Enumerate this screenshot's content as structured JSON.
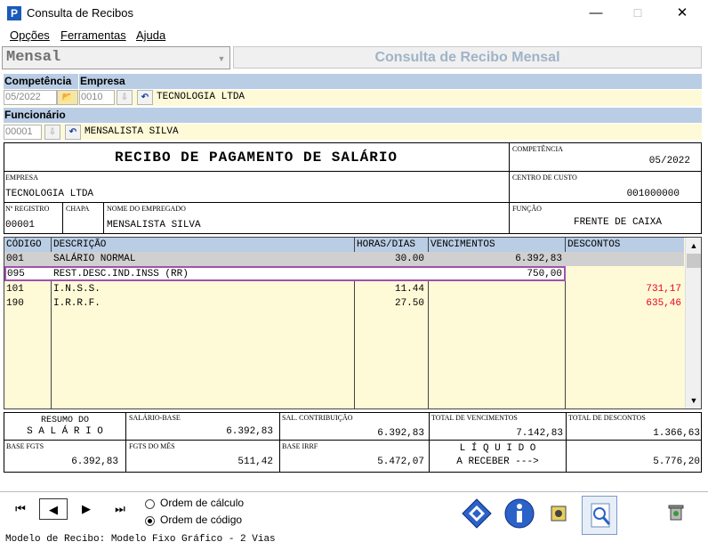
{
  "window": {
    "title": "Consulta de Recibos",
    "icon_letter": "P",
    "minimize": "—",
    "maximize": "☐",
    "close": "✕"
  },
  "menu": [
    "Opções",
    "Ferramentas",
    "Ajuda"
  ],
  "type_combo": {
    "value": "Mensal"
  },
  "header_title": "Consulta de Recibo Mensal",
  "filters": {
    "competencia_label": "Competência",
    "empresa_label": "Empresa",
    "competencia_value": "05/2022",
    "empresa_code": "0010",
    "empresa_name": "TECNOLOGIA LTDA",
    "funcionario_label": "Funcionário",
    "funcionario_code": "00001",
    "funcionario_name": "MENSALISTA SILVA"
  },
  "receipt": {
    "title": "RECIBO DE PAGAMENTO DE SALÁRIO",
    "competencia_label": "COMPETÊNCIA",
    "competencia": "05/2022",
    "empresa_label": "EMPRESA",
    "empresa": "TECNOLOGIA LTDA",
    "centro_label": "CENTRO DE CUSTO",
    "centro": "001000000",
    "registro_label": "Nº REGISTRO",
    "registro": "00001",
    "chapa_label": "CHAPA",
    "nome_label": "NOME DO EMPREGADO",
    "nome": "MENSALISTA SILVA",
    "funcao_label": "FUNÇÃO",
    "funcao": "FRENTE DE CAIXA"
  },
  "grid": {
    "columns": [
      "CÓDIGO",
      "DESCRIÇÃO",
      "HORAS/DIAS",
      "VENCIMENTOS",
      "DESCONTOS"
    ],
    "rows": [
      {
        "codigo": "001",
        "descricao": "SALÁRIO NORMAL",
        "horas": "30.00",
        "vencimentos": "6.392,83",
        "descontos": ""
      },
      {
        "codigo": "095",
        "descricao": "REST.DESC.IND.INSS (RR)",
        "horas": "",
        "vencimentos": "750,00",
        "descontos": ""
      },
      {
        "codigo": "101",
        "descricao": "I.N.S.S.",
        "horas": "11.44",
        "vencimentos": "",
        "descontos": "731,17"
      },
      {
        "codigo": "190",
        "descricao": "I.R.R.F.",
        "horas": "27.50",
        "vencimentos": "",
        "descontos": "635,46"
      }
    ],
    "scroll_up": "▲",
    "scroll_down": "▼"
  },
  "summary": {
    "resumo_line1": "RESUMO DO",
    "resumo_line2": "S A L Á R I O",
    "salario_base_label": "SALÁRIO-BASE",
    "salario_base": "6.392,83",
    "sal_contrib_label": "SAL. CONTRIBUIÇÃO",
    "sal_contrib": "6.392,83",
    "total_venc_label": "TOTAL DE VENCIMENTOS",
    "total_venc": "7.142,83",
    "total_desc_label": "TOTAL DE DESCONTOS",
    "total_desc": "1.366,63",
    "base_fgts_label": "BASE FGTS",
    "base_fgts": "6.392,83",
    "fgts_mes_label": "FGTS DO MÊS",
    "fgts_mes": "511,42",
    "base_irrf_label": "BASE IRRF",
    "base_irrf": "5.472,07",
    "liquido_line1": "L Í Q U I D O",
    "liquido_line2": "A RECEBER --->",
    "liquido": "5.776,20"
  },
  "nav": {
    "first": "⏮",
    "prev": "◀",
    "next": "▶",
    "last": "⏭"
  },
  "order": {
    "option1": "Ordem de cálculo",
    "option2": "Ordem de código",
    "selected": "Ordem de código"
  },
  "status": "Modelo de Recibo: Modelo Fixo Gráfico - 2 Vias",
  "colors": {
    "header_blue": "#b9cde5",
    "field_yellow": "#fefad7",
    "discount_red": "#e8001c",
    "highlight_border": "#a050b0"
  }
}
